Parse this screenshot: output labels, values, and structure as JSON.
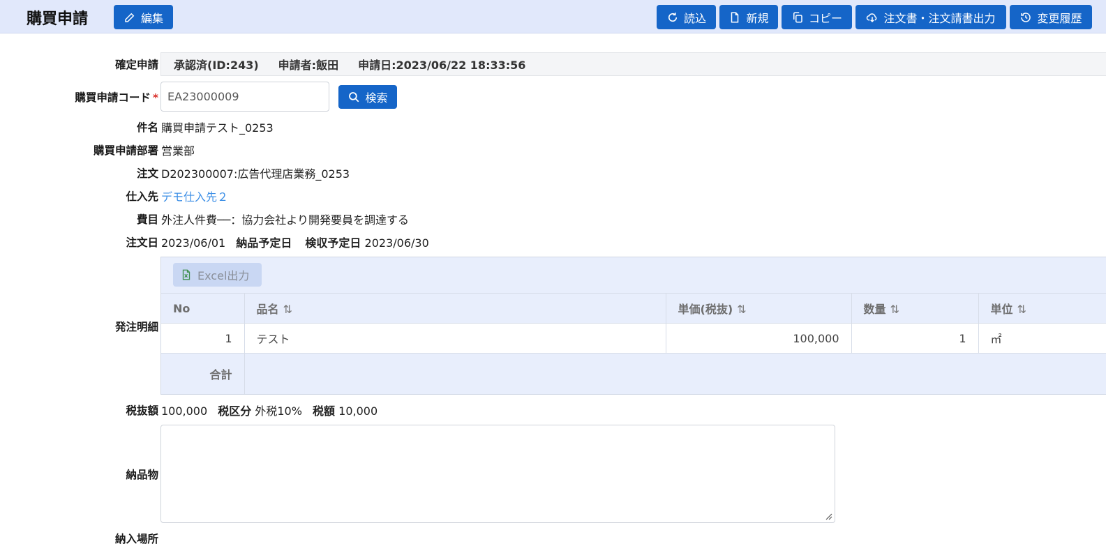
{
  "header": {
    "title": "購買申請",
    "edit_label": "編集",
    "reload_label": "読込",
    "new_label": "新規",
    "copy_label": "コピー",
    "export_label": "注文書・注文請書出力",
    "history_label": "変更履歴"
  },
  "form": {
    "confirmed_label": "確定申請",
    "status": "承認済(ID:243)",
    "applicant": "申請者:飯田",
    "applied_at": "申請日:2023/06/22 18:33:56",
    "code_label": "購買申請コード",
    "code_required": "*",
    "code_value": "EA23000009",
    "search_label": "検索",
    "subject_label": "件名",
    "subject_value": "購買申請テスト_0253",
    "dept_label": "購買申請部署",
    "dept_value": "営業部",
    "order_label": "注文",
    "order_value": "D202300007:広告代理店業務_0253",
    "supplier_label": "仕入先",
    "supplier_value": "デモ仕入先２",
    "expense_label": "費目",
    "expense_value": "外注人件費──：協力会社より開発要員を調達する",
    "order_date_label": "注文日",
    "order_date_value": "2023/06/01",
    "delivery_date_label": "納品予定日",
    "delivery_date_value": "",
    "inspection_date_label": "検収予定日",
    "inspection_date_value": "2023/06/30",
    "details_label": "発注明細",
    "excel_label": "Excel出力",
    "columns": [
      "No",
      "品名",
      "単価(税抜)",
      "数量",
      "単位"
    ],
    "rows": [
      {
        "no": "1",
        "item": "テスト",
        "price": "100,000",
        "qty": "1",
        "unit": "㎡"
      }
    ],
    "total_label": "合計",
    "pretax_label": "税抜額",
    "pretax_value": "100,000",
    "tax_type_label": "税区分",
    "tax_type_value": "外税10%",
    "tax_label": "税額",
    "tax_value": "10,000",
    "deliverables_label": "納品物",
    "deliverables_value": "",
    "delivery_place_label": "納入場所"
  },
  "colors": {
    "header_bg": "#e1e8fb",
    "button": "#1565c8",
    "link": "#3d8fe6",
    "required": "#d9302a",
    "grid_header": "#e8eefc"
  }
}
